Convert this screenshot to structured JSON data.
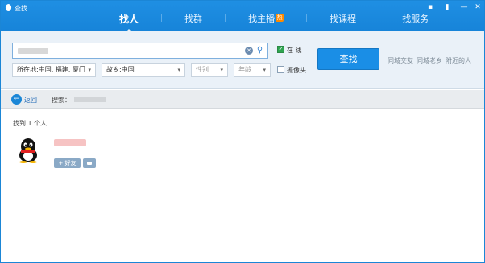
{
  "window": {
    "title": "查找",
    "controls": [
      "chat-icon",
      "lock-icon",
      "minimize-icon",
      "close-icon"
    ]
  },
  "tabs": [
    {
      "label": "找人",
      "active": true
    },
    {
      "label": "找群",
      "active": false
    },
    {
      "label": "找主播",
      "active": false,
      "badge": "热"
    },
    {
      "label": "找课程",
      "active": false
    },
    {
      "label": "找服务",
      "active": false
    }
  ],
  "search": {
    "location": "所在地:中国, 福建, 厦门",
    "hometown": "故乡:中国",
    "gender": "性别",
    "age": "年龄",
    "online_label": "在 线",
    "online_checked": true,
    "camera_label": "摄像头",
    "camera_checked": false,
    "find_button": "查找",
    "quick_links": [
      "同城交友",
      "同城老乡",
      "附近的人"
    ]
  },
  "breadcrumb": {
    "back": "返回",
    "search_label": "搜索："
  },
  "results": {
    "count_text": "找到 1 个人",
    "add_friend": "+ 好友"
  },
  "colors": {
    "titlebar": "#1784d9",
    "panel": "#eaf1f8",
    "button": "#1a8ee6"
  }
}
